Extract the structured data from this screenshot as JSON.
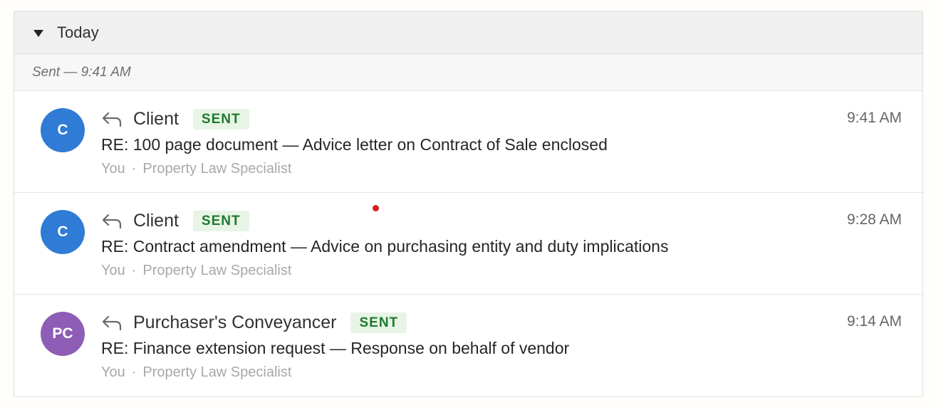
{
  "group": {
    "title": "Today",
    "expanded": true
  },
  "subheader": {
    "label": "Sent — 9:41 AM"
  },
  "messages": [
    {
      "initials": "C",
      "avatar_color": "#2f7bd6",
      "sender": "Client",
      "badge": "SENT",
      "subject": "RE: 100 page document — Advice letter on Contract of Sale enclosed",
      "from": "You",
      "role": "Property Law Specialist",
      "time": "9:41 AM"
    },
    {
      "initials": "C",
      "avatar_color": "#2f7bd6",
      "sender": "Client",
      "badge": "SENT",
      "subject": "RE: Contract amendment — Advice on purchasing entity and duty implications",
      "from": "You",
      "role": "Property Law Specialist",
      "time": "9:28 AM"
    },
    {
      "initials": "PC",
      "avatar_color": "#8e5db5",
      "sender": "Purchaser's Conveyancer",
      "badge": "SENT",
      "subject": "RE: Finance extension request — Response on behalf of vendor",
      "from": "You",
      "role": "Property Law Specialist",
      "time": "9:14 AM"
    }
  ],
  "separator": "·",
  "colors": {
    "badge_bg": "#e7f4e6",
    "badge_text": "#1f7a2c",
    "cursor_dot": "#d62020"
  },
  "icons": {
    "group_toggle": "caret-down-icon",
    "message_status": "reply-arrow-icon"
  }
}
